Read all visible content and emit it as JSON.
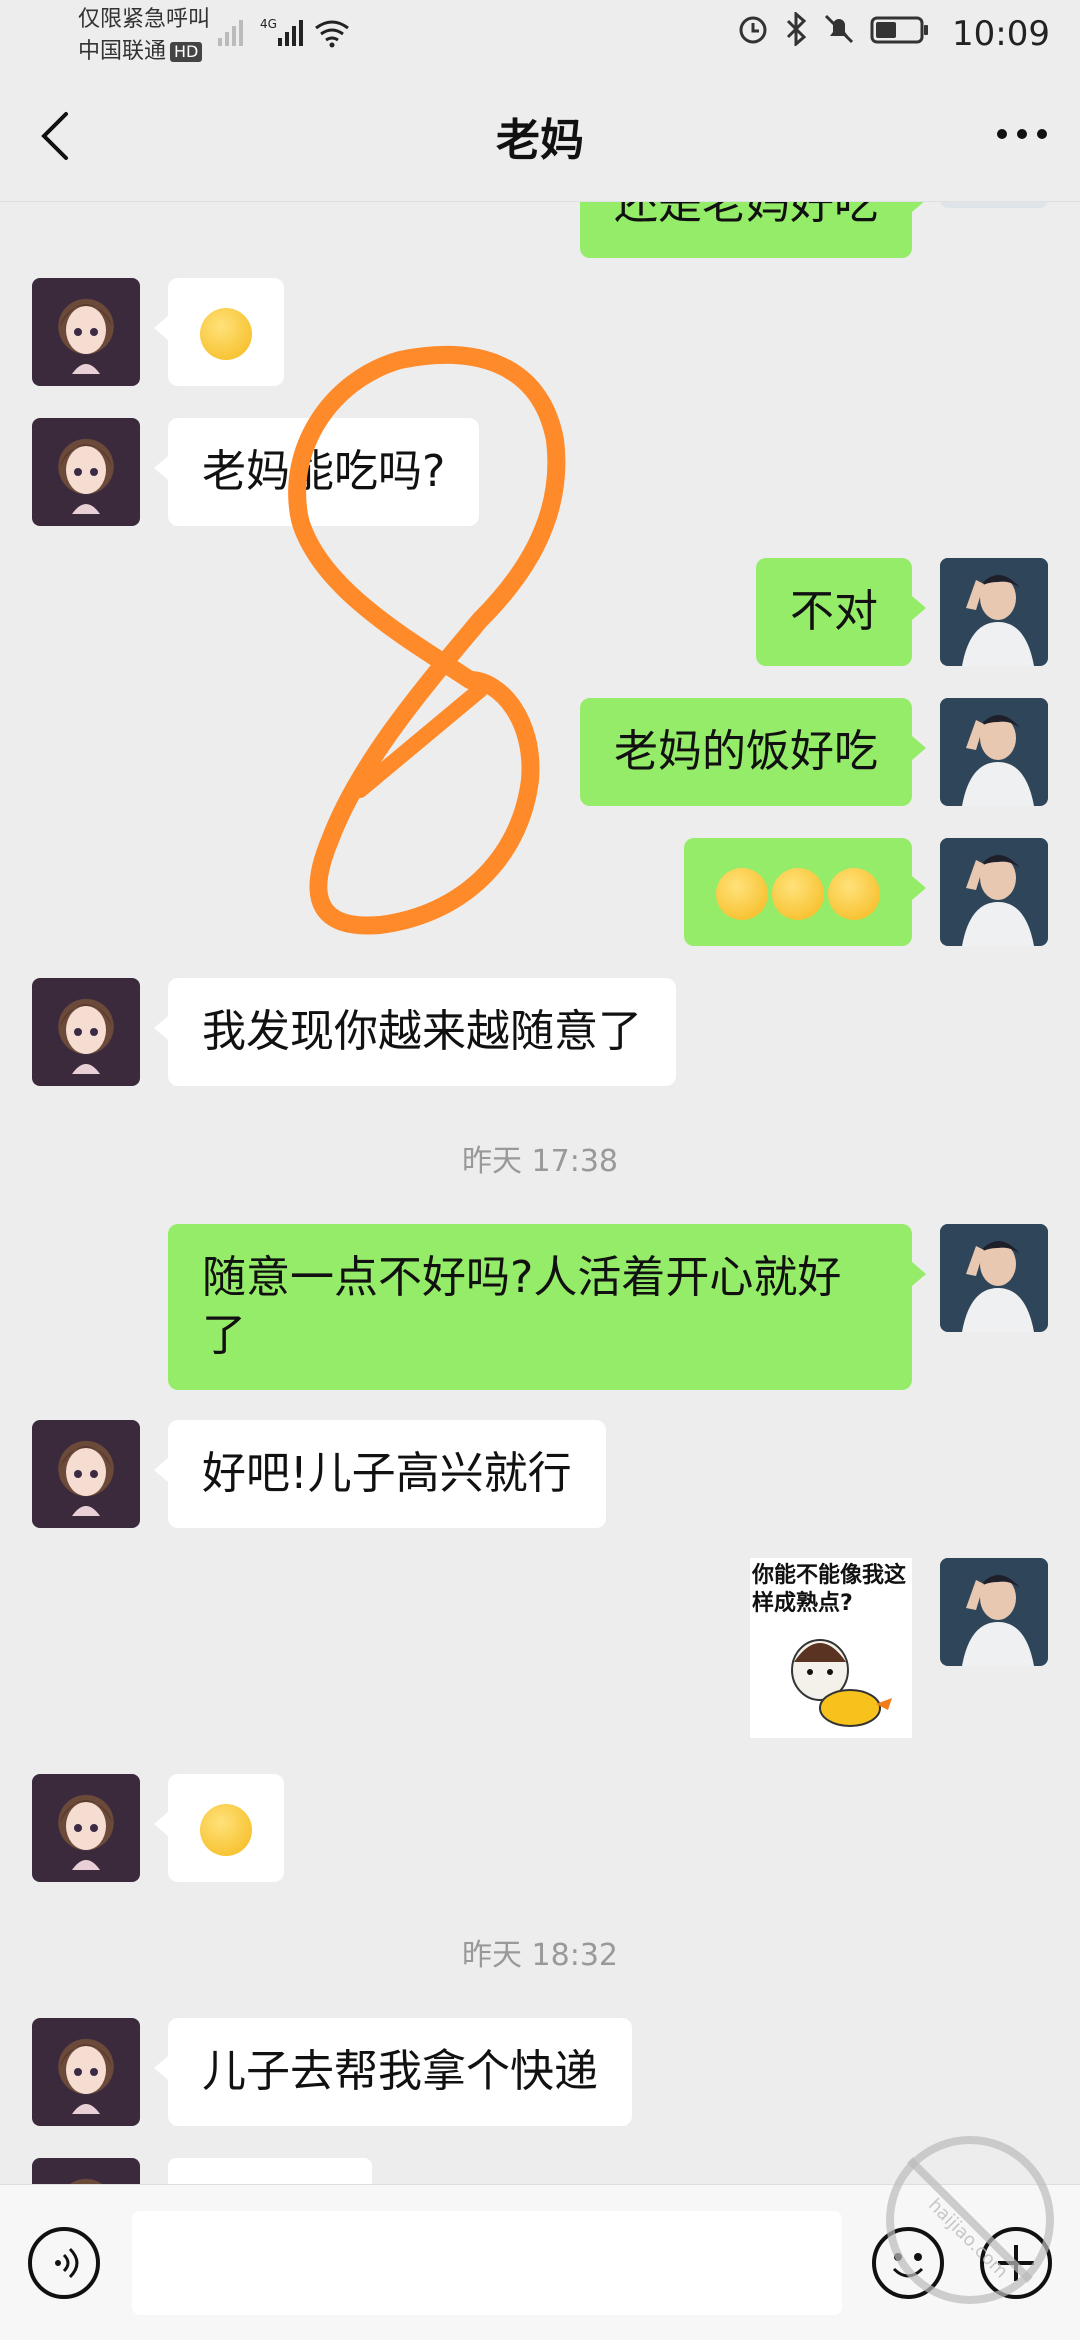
{
  "status_bar": {
    "emergency_text": "仅限紧急呼叫",
    "carrier": "中国联通",
    "hd_badge": "HD",
    "network": "4G",
    "time": "10:09"
  },
  "nav": {
    "title": "老妈"
  },
  "messages": [
    {
      "side": "right",
      "text": "还是老妈好吃"
    },
    {
      "side": "left",
      "type": "emoji",
      "emoji": "grimace-face"
    },
    {
      "side": "left",
      "text": "老妈能吃吗?"
    },
    {
      "side": "right",
      "text": "不对"
    },
    {
      "side": "right",
      "text": "老妈的饭好吃"
    },
    {
      "side": "right",
      "type": "emoji",
      "emoji": "hand-over-mouth-face x3"
    },
    {
      "side": "left",
      "text": "我发现你越来越随意了"
    },
    {
      "type": "timestamp",
      "text": "昨天 17:38"
    },
    {
      "side": "right",
      "text": "随意一点不好吗?人活着开心就好了"
    },
    {
      "side": "left",
      "text": "好吧!儿子高兴就行"
    },
    {
      "side": "right",
      "type": "sticker",
      "text": "你能不能像我这样成熟点?"
    },
    {
      "side": "left",
      "type": "emoji",
      "emoji": "crying-face"
    },
    {
      "type": "timestamp",
      "text": "昨天 18:32"
    },
    {
      "side": "left",
      "text": "儿子去帮我拿个快递"
    }
  ],
  "watermark": {
    "text": "haijiao.com"
  },
  "colors": {
    "sent_bubble": "#95ec69",
    "received_bubble": "#ffffff",
    "background": "#ededed",
    "scribble": "#ff8a2a"
  }
}
